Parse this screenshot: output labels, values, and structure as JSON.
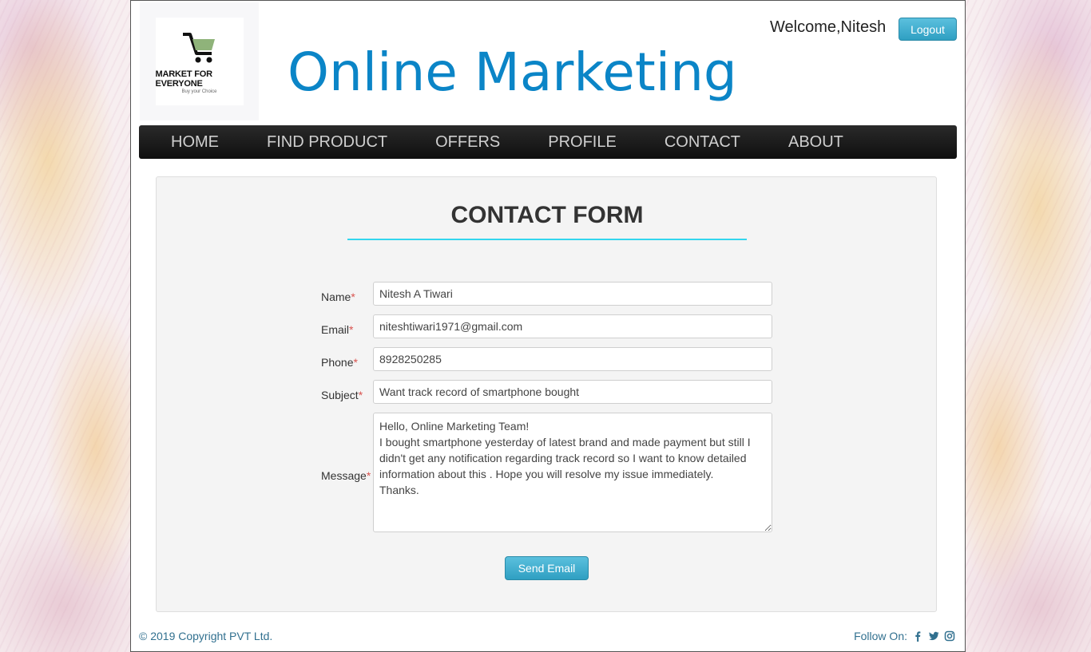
{
  "header": {
    "logo": {
      "main": "MARKET FOR EVERYONE",
      "sub": "Buy your Choice"
    },
    "title": "Online Marketing",
    "welcome": "Welcome,Nitesh",
    "logout_label": "Logout"
  },
  "nav": {
    "items": [
      {
        "label": "HOME"
      },
      {
        "label": "FIND PRODUCT"
      },
      {
        "label": "OFFERS"
      },
      {
        "label": "PROFILE"
      },
      {
        "label": "CONTACT"
      },
      {
        "label": "ABOUT"
      }
    ]
  },
  "form": {
    "title": "CONTACT FORM",
    "required_mark": "*",
    "name": {
      "label": "Name",
      "value": "Nitesh A Tiwari"
    },
    "email": {
      "label": "Email",
      "value": "niteshtiwari1971@gmail.com"
    },
    "phone": {
      "label": "Phone",
      "value": "8928250285"
    },
    "subject": {
      "label": "Subject",
      "value": "Want track record of smartphone bought"
    },
    "message": {
      "label": "Message",
      "value": "Hello, Online Marketing Team!\nI bought smartphone yesterday of latest brand and made payment but still I didn't get any notification regarding track record so I want to know detailed information about this . Hope you will resolve my issue immediately.\nThanks."
    },
    "send_label": "Send Email"
  },
  "footer": {
    "copyright": "© 2019 Copyright PVT Ltd.",
    "follow_label": "Follow On:",
    "social": [
      "facebook-icon",
      "twitter-icon",
      "instagram-icon"
    ]
  },
  "colors": {
    "brand_title": "#0b85c7",
    "button": "#5bc0de",
    "accent_line": "#33d6ee",
    "required": "#d9534f",
    "footer_text": "#31708f"
  }
}
